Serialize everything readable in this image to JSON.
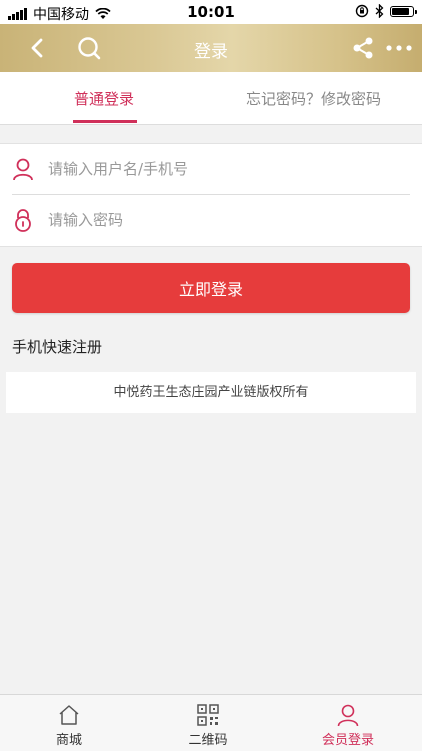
{
  "status_bar": {
    "carrier": "中国移动",
    "time": "10:01",
    "battery_level": 0.9
  },
  "header": {
    "title": "登录"
  },
  "tabs": {
    "login": "普通登录",
    "forgot": "忘记密码？修改密码"
  },
  "form": {
    "username_placeholder": "请输入用户名/手机号",
    "password_placeholder": "请输入密码"
  },
  "actions": {
    "login_button": "立即登录",
    "register_link": "手机快速注册"
  },
  "footer": {
    "copyright": "中悦药王生态庄园产业链版权所有"
  },
  "tabbar": {
    "items": [
      {
        "label": "商城",
        "icon": "home-icon"
      },
      {
        "label": "二维码",
        "icon": "qrcode-icon"
      },
      {
        "label": "会员登录",
        "icon": "user-icon",
        "active": true
      }
    ]
  },
  "colors": {
    "accent": "#d0305a",
    "button": "#e63c3c",
    "header_gold": "#d4c089"
  }
}
